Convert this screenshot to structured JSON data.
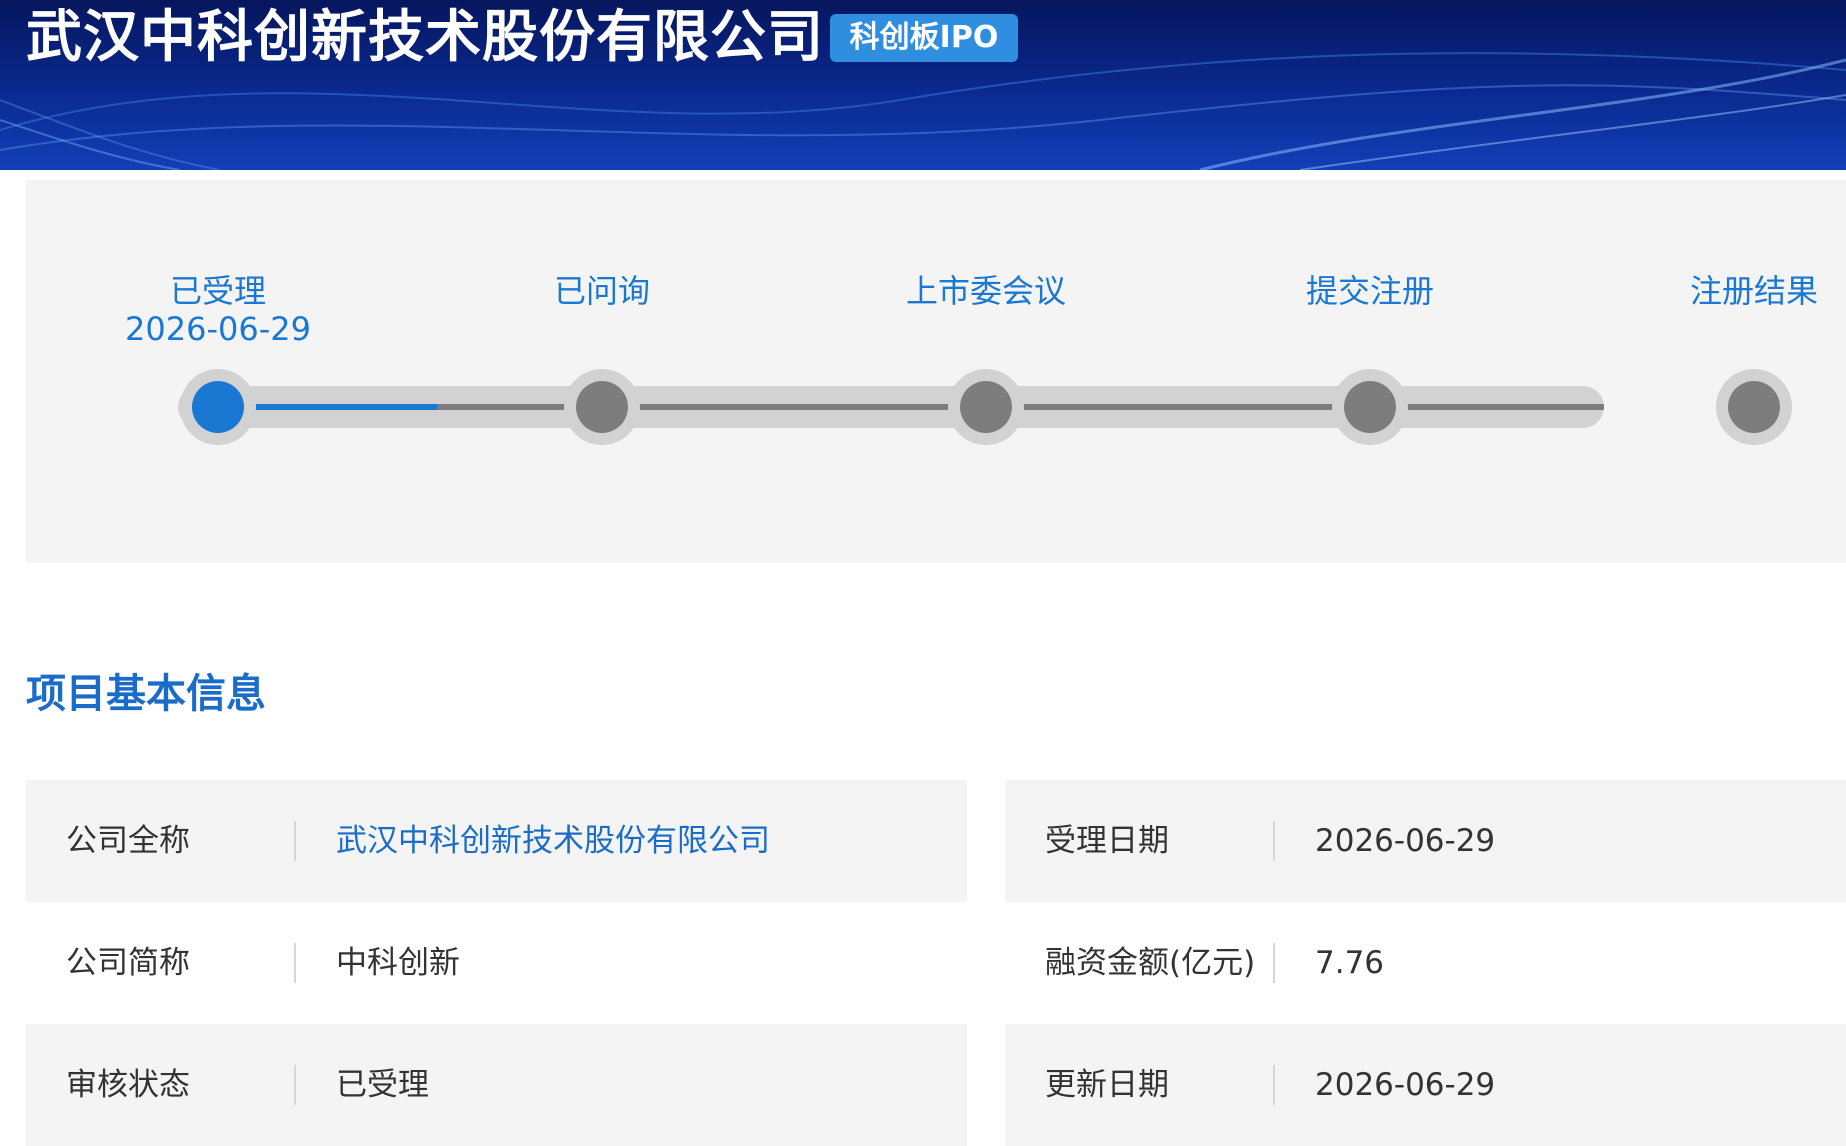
{
  "header": {
    "company_title": "武汉中科创新技术股份有限公司",
    "board_badge": "科创板IPO"
  },
  "progress": {
    "steps": [
      {
        "label": "已受理",
        "date": "2026-06-29",
        "status": "active"
      },
      {
        "label": "已问询",
        "date": "",
        "status": "pending"
      },
      {
        "label": "上市委会议",
        "date": "",
        "status": "pending"
      },
      {
        "label": "提交注册",
        "date": "",
        "status": "pending"
      },
      {
        "label": "注册结果",
        "date": "",
        "status": "pending"
      }
    ],
    "active_color": "#1a78d2",
    "inactive_color": "#7d7d7d"
  },
  "section": {
    "title": "项目基本信息"
  },
  "info": {
    "left": [
      {
        "label": "公司全称",
        "value": "武汉中科创新技术股份有限公司",
        "is_link": true
      },
      {
        "label": "公司简称",
        "value": "中科创新",
        "is_link": false
      },
      {
        "label": "审核状态",
        "value": "已受理",
        "is_link": false
      }
    ],
    "right": [
      {
        "label": "受理日期",
        "value": "2026-06-29"
      },
      {
        "label": "融资金额(亿元)",
        "value": "7.76"
      },
      {
        "label": "更新日期",
        "value": "2026-06-29"
      }
    ]
  },
  "colors": {
    "banner_dark": "#06165e",
    "banner_light": "#123fb8",
    "badge": "#2f8ee0",
    "accent_blue": "#1a6cc8",
    "panel_gray": "#f4f4f4"
  }
}
